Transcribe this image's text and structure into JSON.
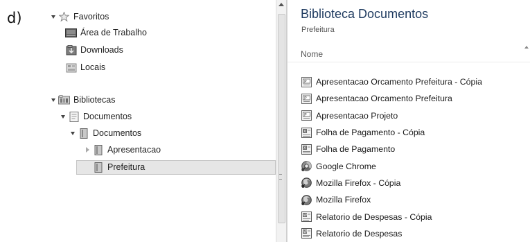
{
  "figure_label": "d)",
  "nav": {
    "favorites": {
      "label": "Favoritos",
      "icon": "star-icon",
      "items": [
        {
          "label": "Área de Trabalho",
          "icon": "desktop-icon"
        },
        {
          "label": "Downloads",
          "icon": "downloads-folder-icon"
        },
        {
          "label": "Locais",
          "icon": "recent-places-icon"
        }
      ]
    },
    "libraries": {
      "label": "Bibliotecas",
      "icon": "libraries-icon",
      "documents_library": {
        "label": "Documentos",
        "icon": "documents-library-icon"
      },
      "documents_folder": {
        "label": "Documentos",
        "icon": "folder-icon"
      },
      "apresentacao": {
        "label": "Apresentacao",
        "icon": "folder-icon"
      },
      "prefeitura": {
        "label": "Prefeitura",
        "icon": "folder-icon",
        "selected": true
      }
    }
  },
  "content": {
    "title": "Biblioteca Documentos",
    "subtitle": "Prefeitura",
    "column_header": "Nome",
    "files": [
      {
        "name": "Apresentacao Orcamento Prefeitura - Cópia",
        "icon": "presentation-file-icon"
      },
      {
        "name": "Apresentacao Orcamento Prefeitura",
        "icon": "presentation-file-icon"
      },
      {
        "name": "Apresentacao Projeto",
        "icon": "presentation-file-icon"
      },
      {
        "name": "Folha de Pagamento - Cópia",
        "icon": "spreadsheet-file-icon"
      },
      {
        "name": "Folha de Pagamento",
        "icon": "spreadsheet-file-icon"
      },
      {
        "name": "Google Chrome",
        "icon": "chrome-shortcut-icon"
      },
      {
        "name": "Mozilla Firefox - Cópia",
        "icon": "firefox-shortcut-icon"
      },
      {
        "name": "Mozilla Firefox",
        "icon": "firefox-shortcut-icon"
      },
      {
        "name": "Relatorio de Despesas - Cópia",
        "icon": "document-file-icon"
      },
      {
        "name": "Relatorio de Despesas",
        "icon": "document-file-icon"
      }
    ]
  }
}
